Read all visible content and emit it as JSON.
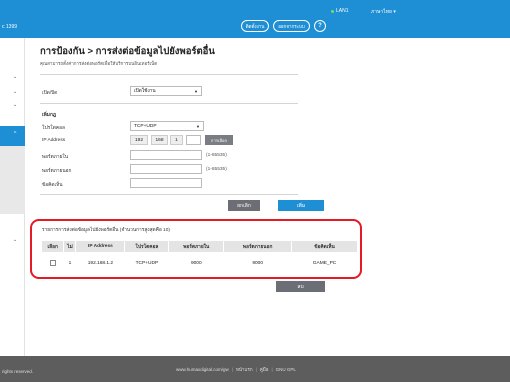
{
  "header": {
    "model": "c 1399",
    "lan_label": "LAN1",
    "language_label": "ภาษาไทย",
    "connect_label": "ติดตั้งงาน",
    "logout_label": "ออกจากระบบ",
    "help_label": "?"
  },
  "page": {
    "title": "การป้องกัน > การส่งต่อข้อมูลไปยังพอร์ตอื่น",
    "subtitle": "คุณสามารถตั้งค่าการส่งต่อพอร์ตเพื่อให้บริการบนอินเทอร์เน็ต"
  },
  "form": {
    "enable_label": "เปิด/ปิด",
    "enable_value": "เปิดใช้งาน",
    "add_heading": "เพิ่มกฎ",
    "protocol_label": "โปรโตคอล",
    "protocol_value": "TCP+UDP",
    "ip_label": "IP Address",
    "ip": [
      "192",
      "168",
      "1"
    ],
    "select_btn": "การเลือก",
    "ext_port_label": "พอร์ตภายใน",
    "ext_port_range": "(1-65535)",
    "int_port_label": "พอร์ตภายนอก",
    "int_port_range": "(1-65535)",
    "desc_label": "ข้อคิดเห็น",
    "cancel_btn": "ยกเลิก",
    "add_btn": "เพิ่ม"
  },
  "table": {
    "caption": "รายการการส่งต่อข้อมูลไปยังพอร์ตอื่น (จำนวนการสูงสุดคือ 10)",
    "headers": [
      "เลือก",
      "ไม่",
      "IP Address",
      "โปรโตคอล",
      "พอร์ตภายใน",
      "พอร์ตภายนอก",
      "ข้อคิดเห็น"
    ],
    "rows": [
      {
        "no": "1",
        "ip": "192.168.1.2",
        "protocol": "TCP+UDP",
        "int_port": "9000",
        "ext_port": "9000",
        "comment": "GAME_PC"
      }
    ],
    "delete_btn": "ลบ"
  },
  "footer": {
    "copyright": "rights reserved.",
    "url": "www.humaxdigital.com/gw",
    "link1": "หน้าแรก",
    "link2": "คู่มือ",
    "link3": "GNU GPL"
  },
  "colors": {
    "accent": "#1e8fd4",
    "highlight": "#e51a24",
    "footer": "#5d5d5d"
  }
}
